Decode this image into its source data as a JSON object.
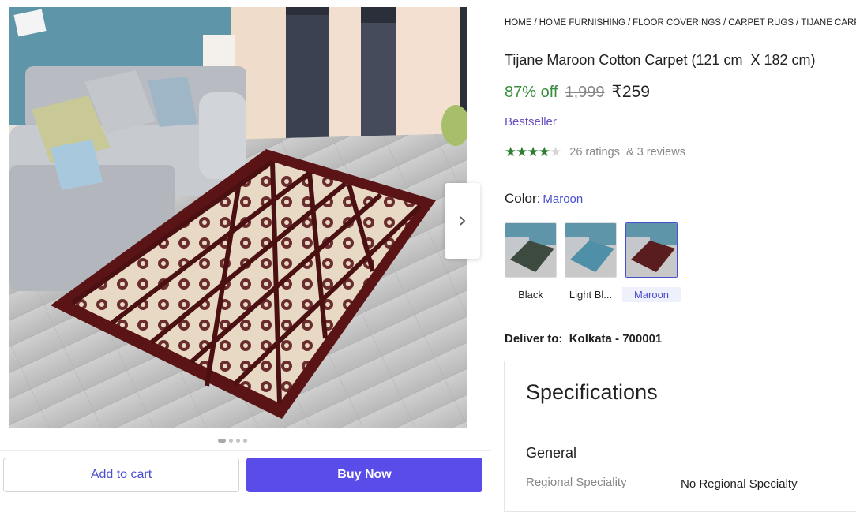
{
  "breadcrumb": [
    "HOME",
    "HOME FURNISHING",
    "FLOOR COVERINGS",
    "CARPET RUGS",
    "TIJANE CARPET"
  ],
  "product": {
    "title": "Tijane Maroon Cotton Carpet (121 cm  X 182 cm)",
    "discount": "87% off",
    "mrp": "1,999",
    "price": "₹259",
    "badge": "Bestseller",
    "rating_value": 4,
    "rating_max": 5,
    "ratings_text": "26 ratings",
    "reviews_text": "& 3 reviews"
  },
  "color": {
    "label": "Color:",
    "selected": "Maroon",
    "options": [
      {
        "label": "Black",
        "tint": "#3d4a3f",
        "selected": false
      },
      {
        "label": "Light Bl...",
        "tint": "#4f8fa8",
        "selected": false
      },
      {
        "label": "Maroon",
        "tint": "#5a1d1f",
        "selected": true
      }
    ]
  },
  "delivery": {
    "label": "Deliver to:",
    "location": "Kolkata - 700001"
  },
  "specifications": {
    "heading": "Specifications",
    "group": "General",
    "rows": [
      {
        "key": "Regional Speciality",
        "value": "No Regional Specialty"
      }
    ]
  },
  "gallery": {
    "total_images": 4,
    "current_index": 1
  },
  "actions": {
    "add_to_cart": "Add to cart",
    "buy_now": "Buy Now"
  },
  "icons": {
    "next": "chevron-right-icon"
  },
  "colors": {
    "accent": "#5a4ce8",
    "discount": "#388e3c",
    "rating": "#2e7d32"
  }
}
